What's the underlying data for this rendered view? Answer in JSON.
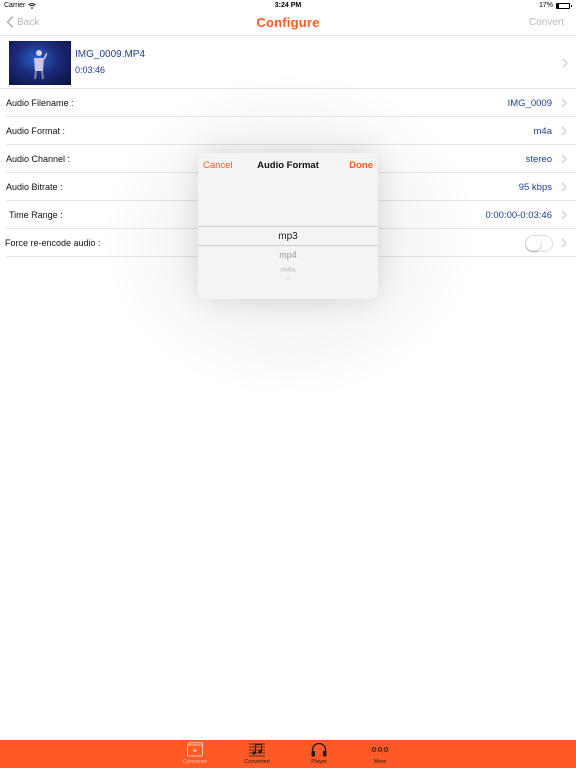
{
  "status_bar": {
    "carrier": "Carrier",
    "time": "3:24 PM",
    "battery": "17%",
    "battery_level": 0.17
  },
  "nav": {
    "back_label": "Back",
    "title": "Configure",
    "convert_label": "Convert"
  },
  "video": {
    "filename": "IMG_0009.MP4",
    "duration": "0:03:46"
  },
  "settings": [
    {
      "label": "Audio Filename :",
      "value": "IMG_0009"
    },
    {
      "label": "Audio Format :",
      "value": "m4a"
    },
    {
      "label": "Audio Channel :",
      "value": "stereo"
    },
    {
      "label": "Audio Bitrate :",
      "value": "95 kbps"
    },
    {
      "label": "Time Range :",
      "value": "0:00:00-0:03:46"
    },
    {
      "label": "Force re-encode audio :",
      "toggle_on": false
    }
  ],
  "popover": {
    "cancel_label": "Cancel",
    "title": "Audio Format",
    "done_label": "Done",
    "options": [
      "mp3",
      "mp4",
      "m4a",
      "flac"
    ]
  },
  "tabs": [
    {
      "label": "Converter",
      "icon": "film-play-icon",
      "active": true
    },
    {
      "label": "Converted",
      "icon": "music-list-icon",
      "active": false
    },
    {
      "label": "Player",
      "icon": "headphones-icon",
      "active": false
    },
    {
      "label": "More",
      "icon": "more-dots-icon",
      "active": false
    }
  ],
  "colors": {
    "accent": "#ff5a1f",
    "value_text": "#1b3f8f",
    "tab_bar": "#ff5a26"
  }
}
